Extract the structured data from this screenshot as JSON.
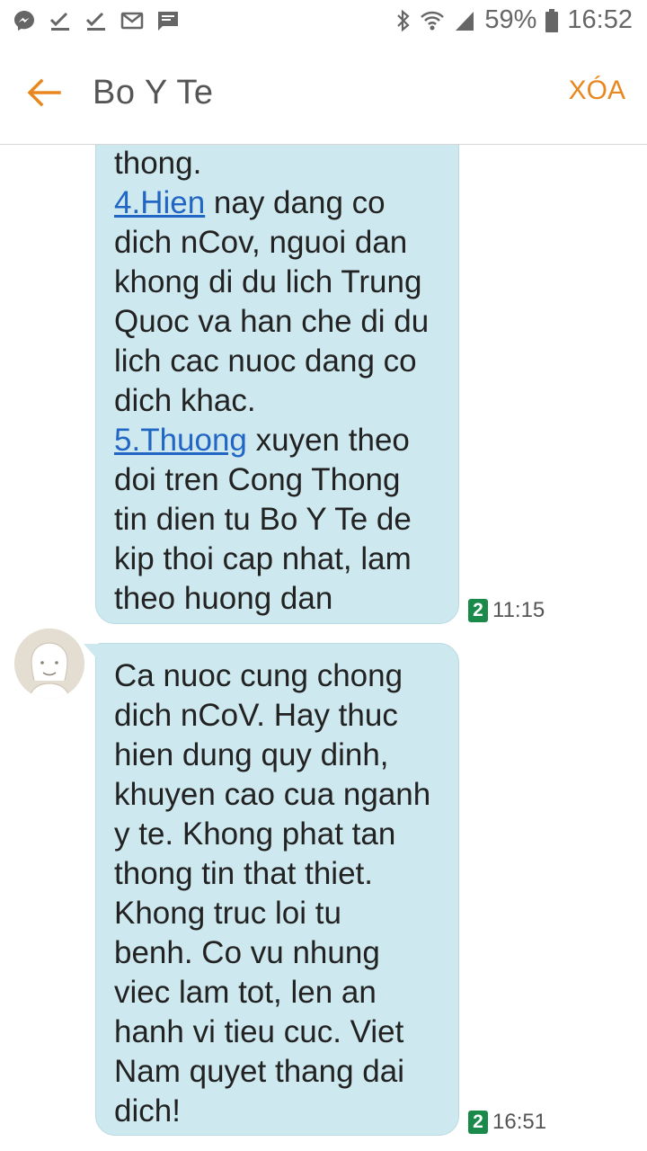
{
  "status_bar": {
    "notification_icons": [
      "messenger-icon",
      "checkmark-icon",
      "checkmark-icon",
      "mail-icon",
      "message-icon"
    ],
    "battery_percent": "59%",
    "time": "16:52"
  },
  "header": {
    "title": "Bo Y Te",
    "delete_label": "XÓA"
  },
  "messages": [
    {
      "lines": [
        {
          "text": "thong."
        },
        {
          "link": "4.Hien",
          "text": " nay dang co"
        },
        {
          "text": "dich nCov, nguoi dan"
        },
        {
          "text": "khong di du lich Trung"
        },
        {
          "text": "Quoc va han che di du"
        },
        {
          "text": "lich cac nuoc dang co"
        },
        {
          "text": "dich khac."
        },
        {
          "link": "5.Thuong",
          "text": " xuyen theo"
        },
        {
          "text": "doi tren Cong Thong"
        },
        {
          "text": "tin dien tu Bo Y Te de"
        },
        {
          "text": "kip thoi cap nhat, lam"
        },
        {
          "text": "theo huong dan"
        }
      ],
      "sim": "2",
      "time": "11:15"
    },
    {
      "lines": [
        {
          "text": "Ca nuoc cung chong"
        },
        {
          "text": "dich nCoV. Hay thuc"
        },
        {
          "text": "hien dung quy dinh,"
        },
        {
          "text": "khuyen cao cua nganh"
        },
        {
          "text": "y te. Khong phat tan"
        },
        {
          "text": "thong tin that thiet."
        },
        {
          "text": "Khong truc loi tu"
        },
        {
          "text": "benh. Co vu nhung"
        },
        {
          "text": "viec lam tot, len an"
        },
        {
          "text": "hanh vi tieu cuc. Viet"
        },
        {
          "text": "Nam quyet thang dai"
        },
        {
          "text": "dich!"
        }
      ],
      "sim": "2",
      "time": "16:51"
    }
  ],
  "colors": {
    "accent": "#e8871e",
    "bubble": "#cde9ef",
    "link": "#2166c4",
    "sim_badge": "#1a8a4a"
  }
}
